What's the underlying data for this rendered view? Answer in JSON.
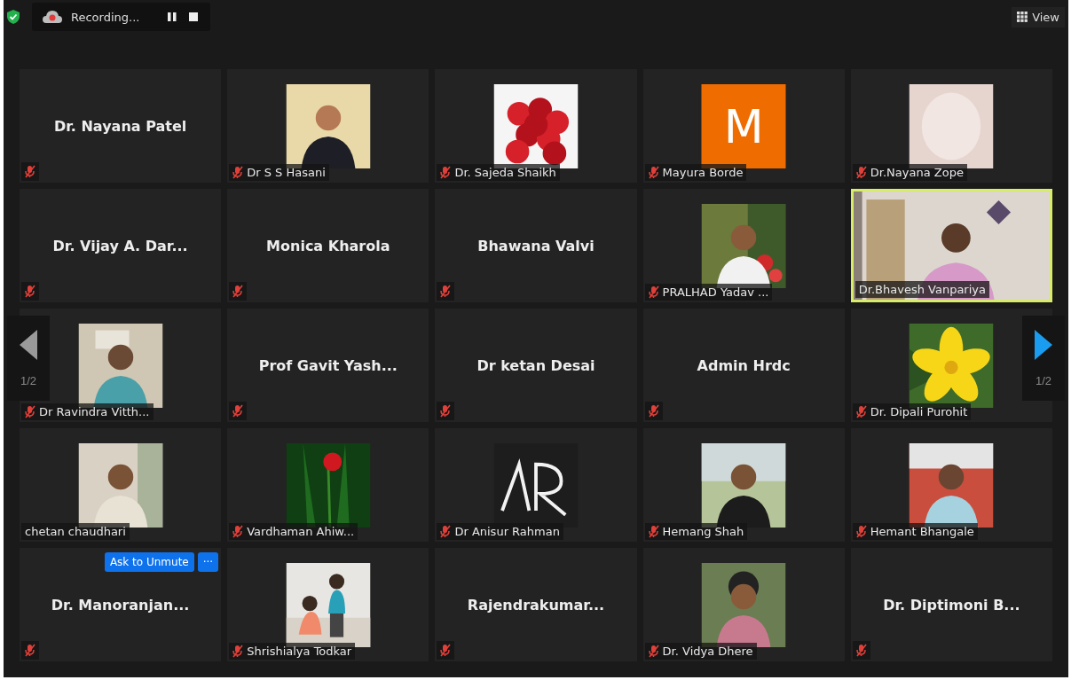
{
  "top_bar": {
    "recording": {
      "label": "Recording...",
      "paused": false
    },
    "view_button": "View"
  },
  "pager": {
    "prev": {
      "label": "1/2",
      "disabled": true
    },
    "next": {
      "label": "1/2",
      "disabled": false
    }
  },
  "tiles": [
    {
      "kind": "name",
      "name": "Dr. Nayana Patel",
      "muted": true,
      "active_speaker": false
    },
    {
      "kind": "picture",
      "name": "Dr S S Hasani",
      "muted": true,
      "active_speaker": false
    },
    {
      "kind": "picture",
      "name": "Dr. Sajeda Shaikh",
      "muted": true,
      "active_speaker": false
    },
    {
      "kind": "avatar",
      "letter": "M",
      "color": "#ef6c00",
      "name": "Mayura Borde",
      "muted": true,
      "active_speaker": false
    },
    {
      "kind": "picture",
      "name": "Dr.Nayana Zope",
      "muted": true,
      "active_speaker": false
    },
    {
      "kind": "name",
      "name": "Dr. Vijay  A. Dar...",
      "muted": true,
      "active_speaker": false
    },
    {
      "kind": "name",
      "name": "Monica Kharola",
      "muted": true,
      "active_speaker": false
    },
    {
      "kind": "name",
      "name": "Bhawana Valvi",
      "muted": true,
      "active_speaker": false
    },
    {
      "kind": "picture",
      "name": "PRALHAD Yadav ...",
      "muted": true,
      "active_speaker": false
    },
    {
      "kind": "video",
      "name": "Dr.Bhavesh Vanpariya",
      "muted": false,
      "active_speaker": true
    },
    {
      "kind": "picture",
      "name": "Dr Ravindra Vitth...",
      "muted": true,
      "active_speaker": false
    },
    {
      "kind": "name",
      "name": "Prof Gavit Yash...",
      "muted": true,
      "active_speaker": false
    },
    {
      "kind": "name",
      "name": "Dr ketan Desai",
      "muted": true,
      "active_speaker": false
    },
    {
      "kind": "name",
      "name": "Admin Hrdc",
      "muted": true,
      "active_speaker": false
    },
    {
      "kind": "picture",
      "name": "Dr. Dipali Purohit",
      "muted": true,
      "active_speaker": false
    },
    {
      "kind": "picture",
      "name": "chetan chaudhari",
      "muted": false,
      "active_speaker": false
    },
    {
      "kind": "picture",
      "name": "Vardhaman Ahiw...",
      "muted": true,
      "active_speaker": false
    },
    {
      "kind": "picture",
      "name": "Dr Anisur Rahman",
      "muted": true,
      "active_speaker": false
    },
    {
      "kind": "picture",
      "name": "Hemang Shah",
      "muted": true,
      "active_speaker": false
    },
    {
      "kind": "picture",
      "name": "Hemant Bhangale",
      "muted": true,
      "active_speaker": false
    },
    {
      "kind": "name",
      "name": "Dr.  Manoranjan...",
      "muted": true,
      "active_speaker": false,
      "actions": {
        "ask_button": "Ask to Unmute",
        "more_button": "···"
      }
    },
    {
      "kind": "picture",
      "name": "Shrishialya Todkar",
      "muted": true,
      "active_speaker": false
    },
    {
      "kind": "name",
      "name": "Rajendrakumar...",
      "muted": true,
      "active_speaker": false
    },
    {
      "kind": "picture",
      "name": "Dr.  Vidya Dhere",
      "muted": true,
      "active_speaker": false
    },
    {
      "kind": "name",
      "name": "Dr. Diptimoni B...",
      "muted": true,
      "active_speaker": false
    }
  ]
}
